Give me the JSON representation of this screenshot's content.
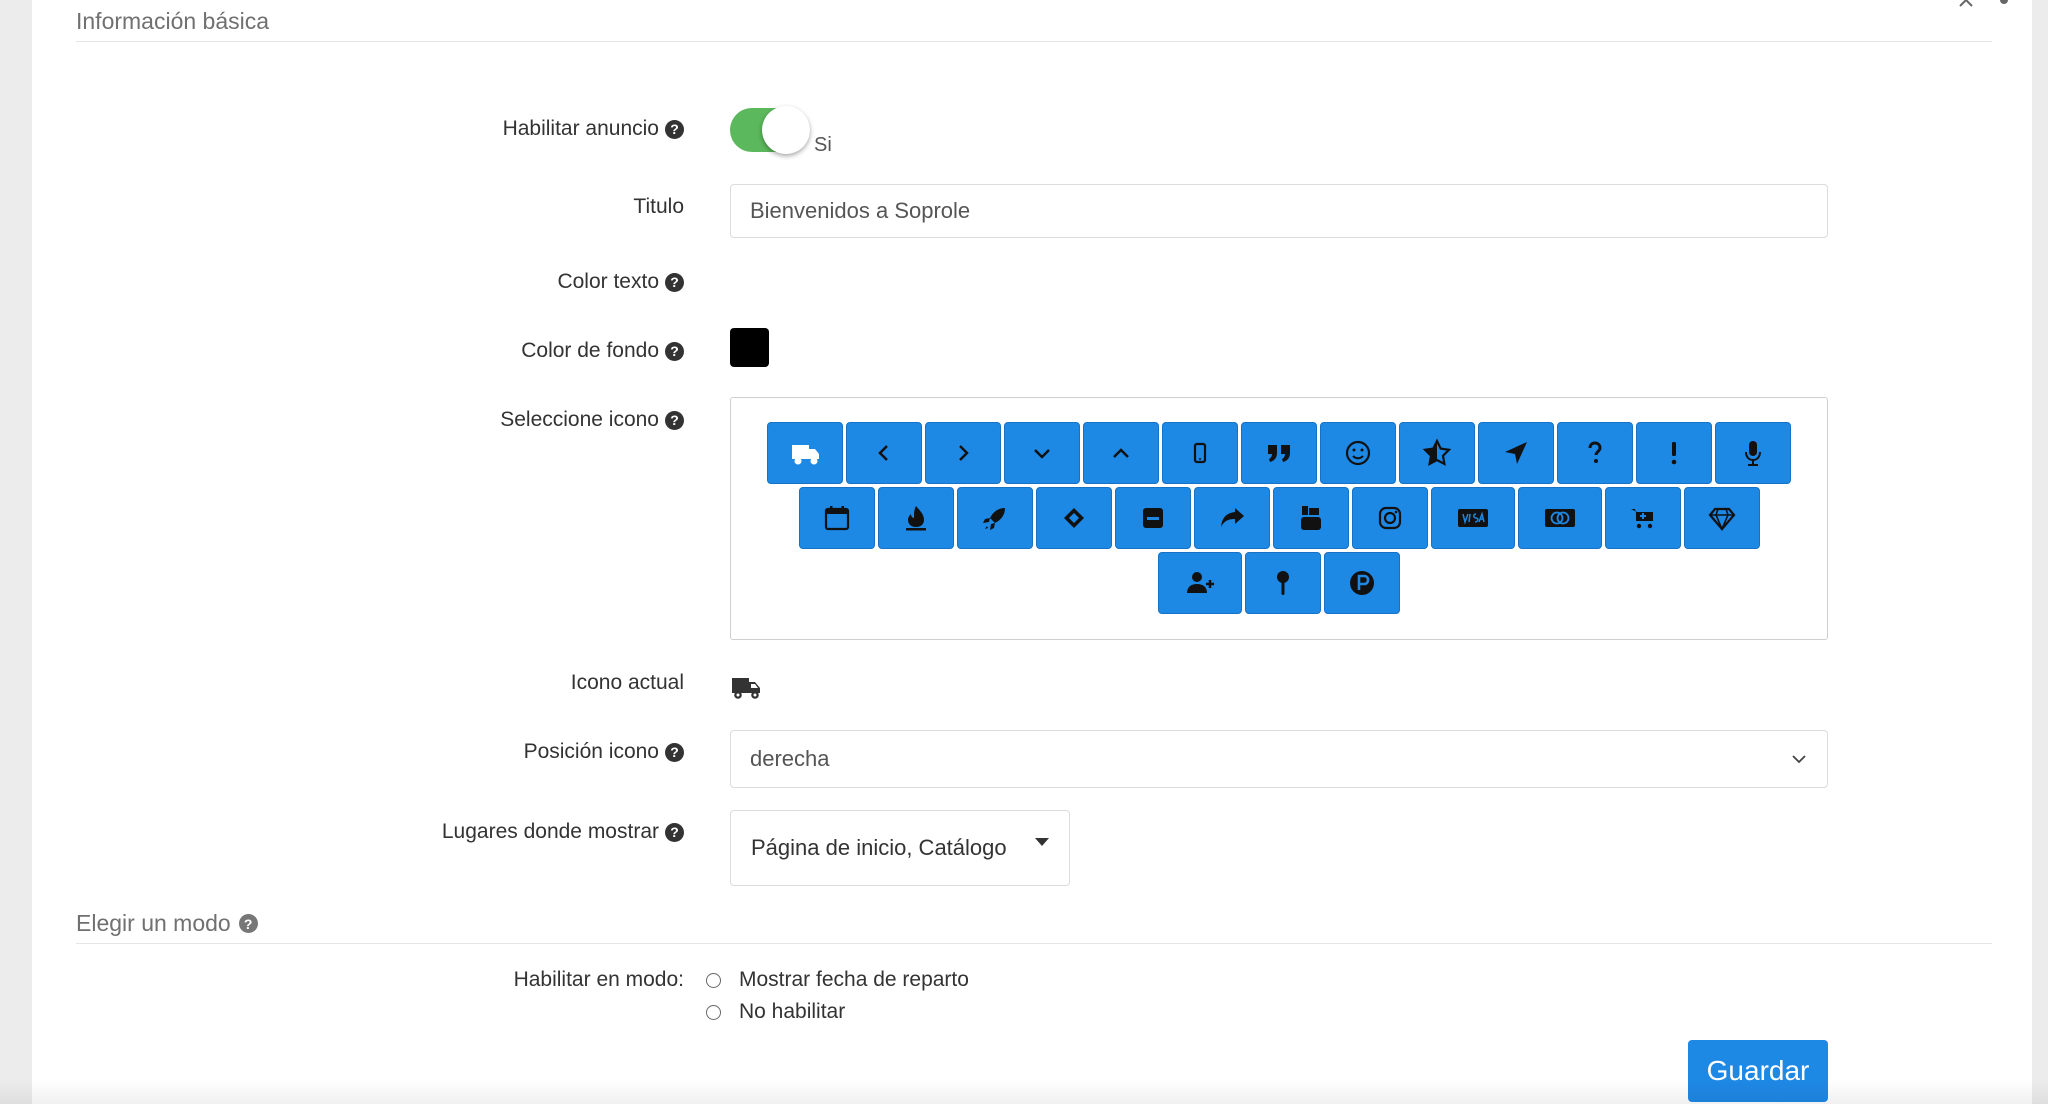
{
  "sections": {
    "basic_info": "Información básica",
    "mode": "Elegir un modo"
  },
  "form": {
    "enable_label": "Habilitar anuncio",
    "enable_value": "Si",
    "title_label": "Titulo",
    "title_value": "Bienvenidos a Soprole",
    "text_color_label": "Color texto",
    "bg_color_label": "Color de fondo",
    "bg_color": "#000000",
    "select_icon_label": "Seleccione icono",
    "current_icon_label": "Icono actual",
    "position_label": "Posición icono",
    "position_value": "derecha",
    "places_label": "Lugares donde mostrar",
    "places_value": "Página de inicio, Catálogo",
    "mode_label": "Habilitar en modo:",
    "mode_options": [
      "Mostrar fecha de reparto",
      "No habilitar"
    ],
    "help_glyph": "?",
    "save_label": "Guardar"
  },
  "icons": {
    "row1": [
      "truck",
      "chevron-left",
      "chevron-right",
      "chevron-down",
      "chevron-up",
      "mobile",
      "quote",
      "smile",
      "star-half",
      "location-arrow",
      "question",
      "exclamation",
      "microphone"
    ],
    "row2": [
      "calendar",
      "fire",
      "rocket",
      "ticket",
      "minus-square",
      "share",
      "youtube",
      "instagram",
      "visa",
      "mastercard",
      "cart-plus",
      "gem"
    ],
    "row3": [
      "user-plus",
      "map-pin",
      "parking"
    ],
    "selected": "truck"
  },
  "colors": {
    "accent": "#1e88e5",
    "toggle_on": "#5cb85c"
  }
}
